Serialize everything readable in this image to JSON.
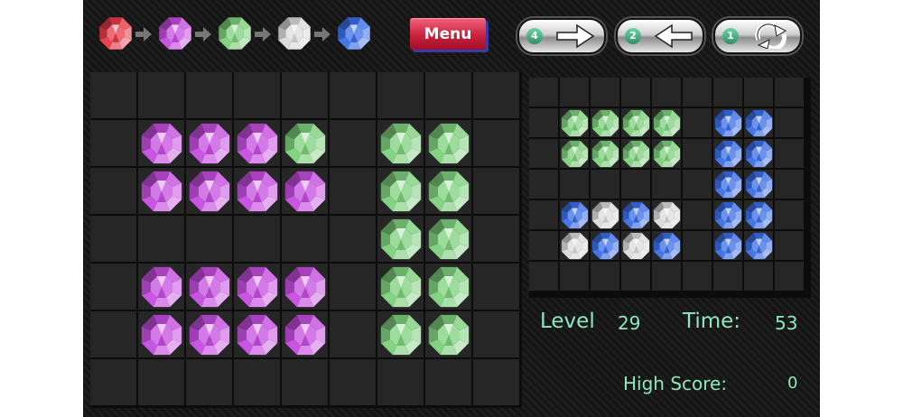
{
  "colors": {
    "red": "#e83a46",
    "purple": "#c64de0",
    "green": "#7ed07e",
    "white": "#dcdcdc",
    "blue": "#3a6fe8",
    "accent": "#8de8c0"
  },
  "chain": [
    "red",
    "purple",
    "green",
    "white",
    "blue"
  ],
  "chain_arrow_icon": "arrow-right-icon",
  "menu": {
    "label": "Menu"
  },
  "tools": [
    {
      "count": "4",
      "icon": "arrow-right-icon"
    },
    {
      "count": "2",
      "icon": "arrow-left-icon"
    },
    {
      "count": "1",
      "icon": "rotate-icon"
    }
  ],
  "main_board": {
    "cols": 9,
    "rows": 7,
    "grid": [
      "---------",
      "-PPPG-GG-",
      "-PPPP-GG-",
      "------GG-",
      "-PPPP-GG-",
      "-PPPP-GG-",
      "---------"
    ]
  },
  "preview_board": {
    "cols": 9,
    "rows": 7,
    "grid": [
      "---------",
      "-GGGG-BB-",
      "-GGGG-BB-",
      "------BB-",
      "-BWBW-BB-",
      "-WBWB-BB-",
      "---------"
    ]
  },
  "stats": {
    "level_label": "Level",
    "level": "29",
    "time_label": "Time:",
    "time": "53",
    "high_score_label": "High Score:",
    "high_score": "0"
  }
}
